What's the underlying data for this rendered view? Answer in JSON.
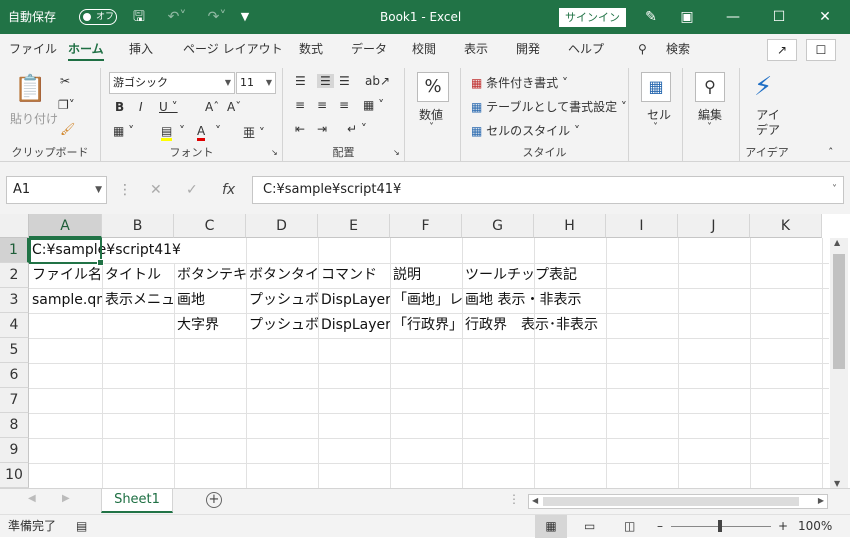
{
  "titlebar": {
    "autosave_label": "自動保存",
    "autosave_state": "オフ",
    "title": "Book1  -  Excel",
    "signin_label": "サインイン"
  },
  "tabs": [
    "ファイル",
    "ホーム",
    "挿入",
    "ページ レイアウト",
    "数式",
    "データ",
    "校閲",
    "表示",
    "開発",
    "ヘルプ"
  ],
  "active_tab": "ホーム",
  "search_label": "検索",
  "ribbon": {
    "clipboard": {
      "paste": "貼り付け",
      "label": "クリップボード"
    },
    "font": {
      "name": "游ゴシック",
      "size": "11",
      "label": "フォント"
    },
    "alignment": {
      "label": "配置"
    },
    "number": {
      "symbol": "%",
      "label_btn": "数値"
    },
    "styles": {
      "conditional": "条件付き書式",
      "table": "テーブルとして書式設定",
      "cell_styles": "セルのスタイル",
      "label": "スタイル"
    },
    "cells": {
      "label_btn": "セル"
    },
    "editing": {
      "label_btn": "編集"
    },
    "ideas": {
      "label_btn": "アイデア",
      "label": "アイデア"
    }
  },
  "formula_bar": {
    "name_box": "A1",
    "fx": "fx",
    "content": "C:¥sample¥script41¥"
  },
  "columns": [
    "A",
    "B",
    "C",
    "D",
    "E",
    "F",
    "G",
    "H",
    "I",
    "J",
    "K"
  ],
  "rows": [
    "1",
    "2",
    "3",
    "4",
    "5",
    "6",
    "7",
    "8",
    "9",
    "10"
  ],
  "cells": {
    "A1": "C:¥sample¥script41¥",
    "A2": "ファイル名",
    "B2": "タイトル",
    "C2": "ボタンテキスト",
    "D2": "ボタンタイプ",
    "E2": "コマンド",
    "F2": "説明",
    "G2": "ツールチップ表記",
    "A3": "sample.qml",
    "B3": "表示メニュー",
    "C3": "画地",
    "D3": "プッシュボタン",
    "E3": "DispLayer",
    "F3": "「画地」レイヤ",
    "G3": "画地 表示・非表示",
    "C4": "大字界",
    "D4": "プッシュボタン",
    "E4": "DispLayer",
    "F4": "「行政界」",
    "G4": "行政界　表示･非表示"
  },
  "sheet_tab": "Sheet1",
  "status": {
    "ready": "準備完了",
    "zoom": "100%"
  }
}
